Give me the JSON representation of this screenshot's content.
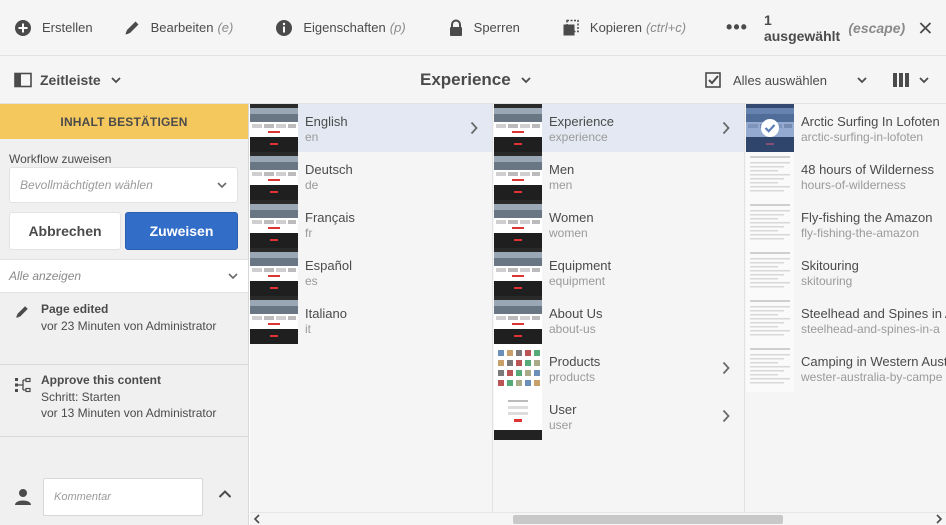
{
  "actionbar": {
    "create": "Erstellen",
    "edit": "Bearbeiten",
    "edit_shortcut": "(e)",
    "properties": "Eigenschaften",
    "properties_shortcut": "(p)",
    "lock": "Sperren",
    "copy": "Kopieren",
    "copy_shortcut": "(ctrl+c)",
    "more": "•••",
    "selection_count": "1 ausgewählt",
    "selection_escape": "(escape)"
  },
  "titlebar": {
    "rail_label": "Zeitleiste",
    "title": "Experience",
    "select_all": "Alles auswählen"
  },
  "rail": {
    "banner": "INHALT BESTÄTIGEN",
    "workflow_label": "Workflow zuweisen",
    "assignee_placeholder": "Bevollmächtigten wählen",
    "cancel": "Abbrechen",
    "assign": "Zuweisen",
    "show_all": "Alle anzeigen",
    "events": [
      {
        "title": "Page edited",
        "line1": "vor 23 Minuten von  Administrator"
      },
      {
        "title": "Approve this content",
        "line1": "Schritt: Starten",
        "line2": "vor 13  Minuten von  Administrator"
      }
    ],
    "comment_placeholder": "Kommentar"
  },
  "columns": {
    "col1": [
      {
        "title": "English",
        "name": "en"
      },
      {
        "title": "Deutsch",
        "name": "de"
      },
      {
        "title": "Français",
        "name": "fr"
      },
      {
        "title": "Español",
        "name": "es"
      },
      {
        "title": "Italiano",
        "name": "it"
      }
    ],
    "col2": [
      {
        "title": "Experience",
        "name": "experience"
      },
      {
        "title": "Men",
        "name": "men"
      },
      {
        "title": "Women",
        "name": "women"
      },
      {
        "title": "Equipment",
        "name": "equipment"
      },
      {
        "title": "About Us",
        "name": "about-us"
      },
      {
        "title": "Products",
        "name": "products"
      },
      {
        "title": "User",
        "name": "user"
      }
    ],
    "col3": [
      {
        "title": "Arctic Surfing In Lofoten",
        "name": "arctic-surfing-in-lofoten"
      },
      {
        "title": "48 hours of Wilderness",
        "name": "hours-of-wilderness"
      },
      {
        "title": "Fly-fishing the Amazon",
        "name": "fly-fishing-the-amazon"
      },
      {
        "title": "Skitouring",
        "name": "skitouring"
      },
      {
        "title": "Steelhead and Spines in Al",
        "name": "steelhead-and-spines-in-a"
      },
      {
        "title": "Camping in Western Austr",
        "name": "wester-australia-by-campe"
      }
    ]
  },
  "colors": {
    "banner": "#f5c85d",
    "primary_button": "#326ec8",
    "active_row": "#e3e8f2"
  }
}
